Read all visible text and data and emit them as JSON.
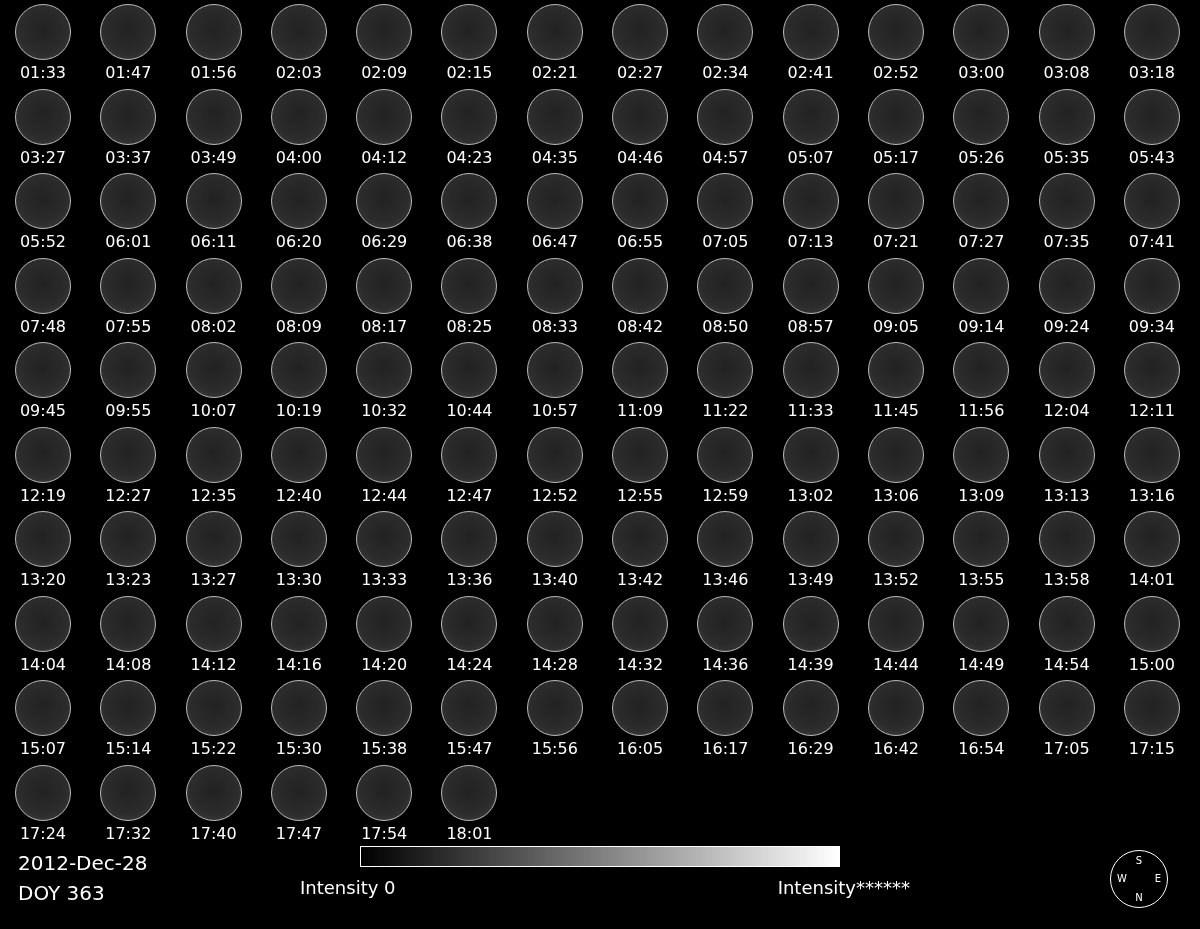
{
  "frames": [
    "01:33",
    "01:47",
    "01:56",
    "02:03",
    "02:09",
    "02:15",
    "02:21",
    "02:27",
    "02:34",
    "02:41",
    "02:52",
    "03:00",
    "03:08",
    "03:18",
    "03:27",
    "03:37",
    "03:49",
    "04:00",
    "04:12",
    "04:23",
    "04:35",
    "04:46",
    "04:57",
    "05:07",
    "05:17",
    "05:26",
    "05:35",
    "05:43",
    "05:52",
    "06:01",
    "06:11",
    "06:20",
    "06:29",
    "06:38",
    "06:47",
    "06:55",
    "07:05",
    "07:13",
    "07:21",
    "07:27",
    "07:35",
    "07:41",
    "07:48",
    "07:55",
    "08:02",
    "08:09",
    "08:17",
    "08:25",
    "08:33",
    "08:42",
    "08:50",
    "08:57",
    "09:05",
    "09:14",
    "09:24",
    "09:34",
    "09:45",
    "09:55",
    "10:07",
    "10:19",
    "10:32",
    "10:44",
    "10:57",
    "11:09",
    "11:22",
    "11:33",
    "11:45",
    "11:56",
    "12:04",
    "12:11",
    "12:19",
    "12:27",
    "12:35",
    "12:40",
    "12:44",
    "12:47",
    "12:52",
    "12:55",
    "12:59",
    "13:02",
    "13:06",
    "13:09",
    "13:13",
    "13:16",
    "13:20",
    "13:23",
    "13:27",
    "13:30",
    "13:33",
    "13:36",
    "13:40",
    "13:42",
    "13:46",
    "13:49",
    "13:52",
    "13:55",
    "13:58",
    "14:01",
    "14:04",
    "14:08",
    "14:12",
    "14:16",
    "14:20",
    "14:24",
    "14:28",
    "14:32",
    "14:36",
    "14:39",
    "14:44",
    "14:49",
    "14:54",
    "15:00",
    "15:07",
    "15:14",
    "15:22",
    "15:30",
    "15:38",
    "15:47",
    "15:56",
    "16:05",
    "16:17",
    "16:29",
    "16:42",
    "16:54",
    "17:05",
    "17:15",
    "17:24",
    "17:32",
    "17:40",
    "17:47",
    "17:54",
    "18:01"
  ],
  "date": "2012-Dec-28",
  "doy": "DOY 363",
  "colorbar": {
    "min_label": "Intensity 0",
    "max_label": "Intensity******"
  },
  "compass": {
    "top": "S",
    "left": "W",
    "right": "E",
    "bottom": "N"
  }
}
